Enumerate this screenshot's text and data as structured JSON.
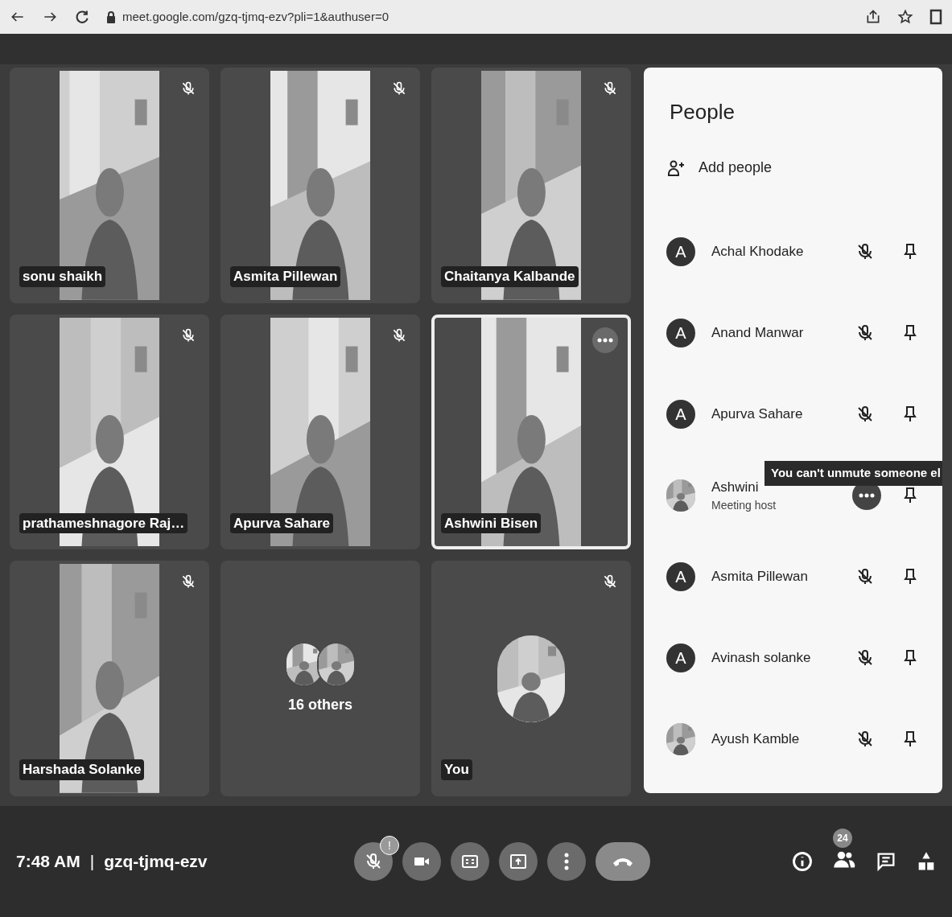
{
  "browser": {
    "url": "meet.google.com/gzq-tjmq-ezv?pli=1&authuser=0"
  },
  "tiles": [
    {
      "kind": "video",
      "name": "sonu shaikh",
      "muted": true,
      "highlighted": false
    },
    {
      "kind": "video",
      "name": "Asmita Pillewan",
      "muted": true,
      "highlighted": false
    },
    {
      "kind": "video",
      "name": "Chaitanya Kalbande",
      "muted": true,
      "highlighted": false
    },
    {
      "kind": "video",
      "name": "prathameshnagore Raj…",
      "muted": true,
      "highlighted": false
    },
    {
      "kind": "video",
      "name": "Apurva Sahare",
      "muted": true,
      "highlighted": false
    },
    {
      "kind": "video",
      "name": "Ashwini Bisen",
      "muted": false,
      "highlighted": true
    },
    {
      "kind": "video",
      "name": "Harshada Solanke",
      "muted": true,
      "highlighted": false
    },
    {
      "kind": "others",
      "name": "16 others",
      "muted": false,
      "highlighted": false
    },
    {
      "kind": "self",
      "name": "You",
      "muted": true,
      "highlighted": false
    }
  ],
  "people_panel": {
    "title": "People",
    "add_label": "Add people",
    "people": [
      {
        "kind": "initial",
        "initial": "A",
        "name": "Achal Khodake",
        "hovered": false
      },
      {
        "kind": "initial",
        "initial": "A",
        "name": "Anand Manwar",
        "hovered": false
      },
      {
        "kind": "initial",
        "initial": "A",
        "name": "Apurva Sahare",
        "hovered": false
      },
      {
        "kind": "picture",
        "name": "Ashwini",
        "subtitle": "Meeting host",
        "hovered": true
      },
      {
        "kind": "initial",
        "initial": "A",
        "name": "Asmita Pillewan",
        "hovered": false
      },
      {
        "kind": "initial",
        "initial": "A",
        "name": "Avinash solanke",
        "hovered": false
      },
      {
        "kind": "picture",
        "name": "Ayush Kamble",
        "hovered": false
      }
    ],
    "tooltip": "You can't unmute someone el"
  },
  "bottom_bar": {
    "time": "7:48 AM",
    "separator": "|",
    "meeting_code": "gzq-tjmq-ezv",
    "mic_badge": "!",
    "people_count": "24"
  }
}
